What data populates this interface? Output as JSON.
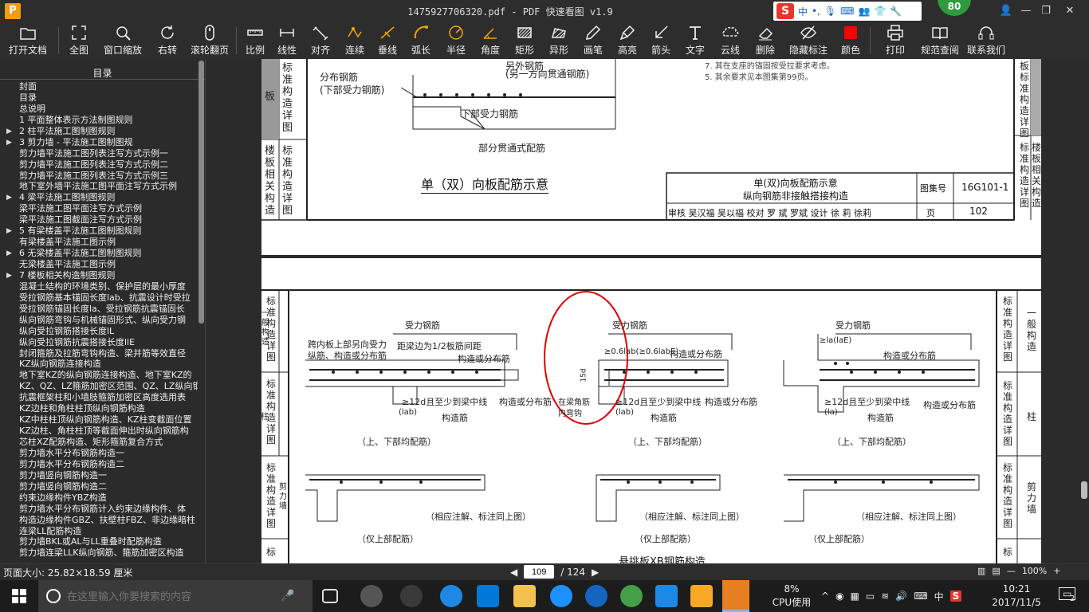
{
  "window": {
    "title": "1475927706320.pdf - PDF 快速看图 v1.9",
    "logo": "P",
    "score": "80",
    "ime_label": "中"
  },
  "toolbar": [
    {
      "id": "open",
      "label": "打开文档",
      "icon": "folder-icon"
    },
    {
      "id": "fit",
      "label": "全图",
      "icon": "fullscreen-icon"
    },
    {
      "id": "zoomwin",
      "label": "窗口缩放",
      "icon": "magnifier-icon"
    },
    {
      "id": "rotate",
      "label": "右转",
      "icon": "rotate-right-icon"
    },
    {
      "id": "scroll",
      "label": "滚轮翻页",
      "icon": "mouse-icon"
    },
    {
      "id": "scale",
      "label": "比例",
      "icon": "ruler-icon"
    },
    {
      "id": "linear",
      "label": "线性",
      "icon": "linear-dim-icon"
    },
    {
      "id": "align",
      "label": "对齐",
      "icon": "aligned-dim-icon"
    },
    {
      "id": "continuous",
      "label": "连续",
      "icon": "continuous-dim-icon"
    },
    {
      "id": "perp",
      "label": "垂线",
      "icon": "perpendicular-icon"
    },
    {
      "id": "arc",
      "label": "弧长",
      "icon": "arc-length-icon"
    },
    {
      "id": "radius",
      "label": "半径",
      "icon": "radius-icon"
    },
    {
      "id": "angle",
      "label": "角度",
      "icon": "angle-icon"
    },
    {
      "id": "rect",
      "label": "矩形",
      "icon": "rect-area-icon"
    },
    {
      "id": "irregular",
      "label": "异形",
      "icon": "irregular-area-icon"
    },
    {
      "id": "pen",
      "label": "画笔",
      "icon": "pen-icon"
    },
    {
      "id": "highlight",
      "label": "高亮",
      "icon": "highlighter-icon"
    },
    {
      "id": "arrow",
      "label": "箭头",
      "icon": "arrow-icon"
    },
    {
      "id": "text",
      "label": "文字",
      "icon": "text-icon"
    },
    {
      "id": "cloud",
      "label": "云线",
      "icon": "cloud-line-icon"
    },
    {
      "id": "delete",
      "label": "删除",
      "icon": "eraser-icon"
    },
    {
      "id": "hide",
      "label": "隐藏标注",
      "icon": "eye-hide-icon"
    },
    {
      "id": "color",
      "label": "颜色",
      "icon": "color-swatch-icon"
    },
    {
      "id": "print",
      "label": "打印",
      "icon": "printer-icon"
    },
    {
      "id": "spec",
      "label": "规范查阅",
      "icon": "book-icon"
    },
    {
      "id": "contact",
      "label": "联系我们",
      "icon": "headset-icon"
    }
  ],
  "sidebar": {
    "header": "目录",
    "items": [
      {
        "label": "封面",
        "arrow": false
      },
      {
        "label": "目录",
        "arrow": false
      },
      {
        "label": "总说明",
        "arrow": false
      },
      {
        "label": "1 平面整体表示方法制图规则",
        "arrow": false
      },
      {
        "label": "2 柱平法施工图制图规则",
        "arrow": true
      },
      {
        "label": "3 剪力墙 - 平法施工图制图规",
        "arrow": true
      },
      {
        "label": "剪力墙平法施工图列表注写方式示例一",
        "arrow": false
      },
      {
        "label": "剪力墙平法施工图列表注写方式示例二",
        "arrow": false
      },
      {
        "label": "剪力墙平法施工图列表注写方式示例三",
        "arrow": false
      },
      {
        "label": "地下室外墙平法施工图平面注写方式示例",
        "arrow": false
      },
      {
        "label": "4 梁平法施工图制图规则",
        "arrow": true
      },
      {
        "label": "梁平法施工图平面注写方式示例",
        "arrow": false
      },
      {
        "label": "梁平法施工图截面注写方式示例",
        "arrow": false
      },
      {
        "label": "5 有梁楼盖平法施工图制图规则",
        "arrow": true
      },
      {
        "label": "有梁楼盖平法施工图示例",
        "arrow": false
      },
      {
        "label": "6 无梁楼盖平法施工图制图规则",
        "arrow": true
      },
      {
        "label": "无梁楼盖平法施工图示例",
        "arrow": false
      },
      {
        "label": "7 楼板相关构造制图规则",
        "arrow": true
      },
      {
        "label": "混凝土结构的环境类别、保护层的最小厚度",
        "arrow": false
      },
      {
        "label": "受拉钢筋基本锚固长度lab、抗震设计时受拉",
        "arrow": false
      },
      {
        "label": "受拉钢筋锚固长度la、受拉钢筋抗震锚固长",
        "arrow": false
      },
      {
        "label": "纵向钢筋弯钩与机械锚固形式、纵向受力钢",
        "arrow": false
      },
      {
        "label": "纵向受拉钢筋搭接长度lL",
        "arrow": false
      },
      {
        "label": "纵向受拉钢筋抗震搭接长度llE",
        "arrow": false
      },
      {
        "label": "封闭箍筋及拉筋弯钩构造、梁并筋等效直径",
        "arrow": false
      },
      {
        "label": "KZ纵向钢筋连接构造",
        "arrow": false
      },
      {
        "label": "地下室KZ的纵向钢筋连接构造、地下室KZ的",
        "arrow": false
      },
      {
        "label": "KZ、QZ、LZ箍筋加密区范围、QZ、LZ纵向钢",
        "arrow": false
      },
      {
        "label": "抗震框架柱和小墙肢箍筋加密区高度选用表",
        "arrow": false
      },
      {
        "label": "KZ边柱和角柱柱顶纵向钢筋构造",
        "arrow": false
      },
      {
        "label": "KZ中柱柱顶纵向钢筋构造、KZ柱变截面位置",
        "arrow": false
      },
      {
        "label": "KZ边柱、角柱柱顶等截面伸出时纵向钢筋构",
        "arrow": false
      },
      {
        "label": "芯柱XZ配筋构造、矩形箍筋复合方式",
        "arrow": false
      },
      {
        "label": "剪力墙水平分布钢筋构造一",
        "arrow": false
      },
      {
        "label": "剪力墙水平分布钢筋构造二",
        "arrow": false
      },
      {
        "label": "剪力墙竖向钢筋构造一",
        "arrow": false
      },
      {
        "label": "剪力墙竖向钢筋构造二",
        "arrow": false
      },
      {
        "label": "约束边缘构件YBZ构造",
        "arrow": false
      },
      {
        "label": "剪力墙水平分布钢筋计入约束边缘构件、体",
        "arrow": false
      },
      {
        "label": "构造边缘构件GBZ、扶壁柱FBZ、非边缘暗柱",
        "arrow": false
      },
      {
        "label": "连梁LL配筋构造",
        "arrow": false
      },
      {
        "label": "剪力墙BKL或AL与LL重叠时配筋构造",
        "arrow": false
      },
      {
        "label": "剪力墙连梁LLK纵向钢筋、箍筋加密区构造",
        "arrow": false
      }
    ]
  },
  "page1": {
    "left_cell_top": [
      "标",
      "准",
      "构",
      "造",
      "详",
      "图"
    ],
    "left_cell_top_side": "板",
    "left_cell_bottom": "楼板相关构造",
    "left_cell_bottom_b": [
      "标",
      "准",
      "构",
      "造",
      "详",
      "图"
    ],
    "labels": {
      "rebar_top": "分布钢筋",
      "rebar_sub": "(下部受力钢筋)",
      "rebar_other": "(另一方向贯通钢筋)",
      "rebar_other_top": "另外钢筋",
      "lower_rebar": "下部受力钢筋",
      "partial": "部分贯通式配筋"
    },
    "notes": [
      "7. 其在支座的锚固按受拉要求考虑。",
      "5. 其余要求见本图集第99页。"
    ],
    "caption": "单（双）向板配筋示意",
    "titleblock": {
      "title1": "单(双)向板配筋示意",
      "title2": "纵向钢筋非接触搭接构造",
      "atlas_label": "图集号",
      "atlas_no": "16G101-1",
      "page_label": "页",
      "page_no": "102",
      "sign_row": "审核  吴汉福  吴以福  校对  罗  斌  罗斌  设计  徐  莉  徐莉"
    },
    "right_top": [
      "板",
      "标",
      "准",
      "构",
      "造",
      "详",
      "图"
    ],
    "right_bottom": [
      "标",
      "准",
      "构",
      "造",
      "详",
      "图"
    ],
    "right_bottom_b": "楼板相关构造"
  },
  "page2": {
    "left_groups": [
      {
        "a": [
          "标",
          "准",
          "构",
          "造",
          "详",
          "图"
        ],
        "b": "一般构造"
      },
      {
        "a": [
          "标",
          "准",
          "构",
          "造",
          "详",
          "图"
        ],
        "b": "柱"
      },
      {
        "a": [
          "标",
          "准",
          "构",
          "造",
          "详",
          "图"
        ],
        "b": "剪力墙"
      },
      {
        "a": [
          "标"
        ],
        "b": ""
      }
    ],
    "right_groups": [
      {
        "a": [
          "标",
          "准",
          "构",
          "造",
          "详",
          "图"
        ],
        "b": "一般构造"
      },
      {
        "a": [
          "标",
          "准",
          "构",
          "造",
          "详",
          "图"
        ],
        "b": "柱"
      },
      {
        "a": [
          "标",
          "准",
          "构",
          "造",
          "详",
          "图"
        ],
        "b": "剪力墙"
      },
      {
        "a": [
          "标"
        ],
        "b": ""
      }
    ],
    "fig1": {
      "top": "受力钢筋",
      "a": "跨内板上部另向受力",
      "b": "纵筋、构造或分布筋",
      "c": "距梁边为1/2板筋间距",
      "d": "构造或分布筋",
      "e": "≥12d且至少到梁中线",
      "f": "(lab)",
      "g": "构造筋",
      "h": "构造或分布筋",
      "cap": "（上、下部均配筋）"
    },
    "fig2": {
      "top": "受力钢筋",
      "a": "≥0.6lab(≥0.6labE)",
      "b": "构造或分布筋",
      "v": "15d",
      "c": "在梁角筋",
      "d": "内弯钩",
      "e": "≥12d且至少到梁中线",
      "f": "(lab)",
      "g": "构造筋",
      "h": "构造或分布筋",
      "cap": "（上、下部均配筋）"
    },
    "fig3": {
      "top": "受力钢筋",
      "a": "≥la(laE)",
      "b": "构造或分布筋",
      "e": "≥12d且至少到梁中线",
      "f": "(la)",
      "g": "构造筋",
      "h": "构造或分布筋",
      "cap": "（上、下部均配筋）"
    },
    "row2": {
      "n1": "（相应注解、标注同上图）",
      "n2": "（相应注解、标注同上图）",
      "n3": "（相应注解、标注同上图）",
      "c1": "（仅上部配筋）",
      "c2": "（仅上部配筋）",
      "c3": "（仅上部配筋）"
    },
    "bottom_title": "悬挑板XB钢筋构造"
  },
  "status": {
    "page_size": "页面大小: 25.82×18.59 厘米",
    "current_page": "109",
    "total_pages": "/ 124",
    "zoom": "100%"
  },
  "taskbar": {
    "search_placeholder": "在这里输入你要搜索的内容",
    "cpu_pct": "8%",
    "cpu_label": "CPU使用",
    "ime": "中",
    "time": "10:21",
    "date": "2017/11/5",
    "notif": "2"
  },
  "colors": {
    "accent": "#f39c12",
    "annotation": "#e00000",
    "ime_red": "#e8352d",
    "score_green": "#2e9b3c"
  }
}
